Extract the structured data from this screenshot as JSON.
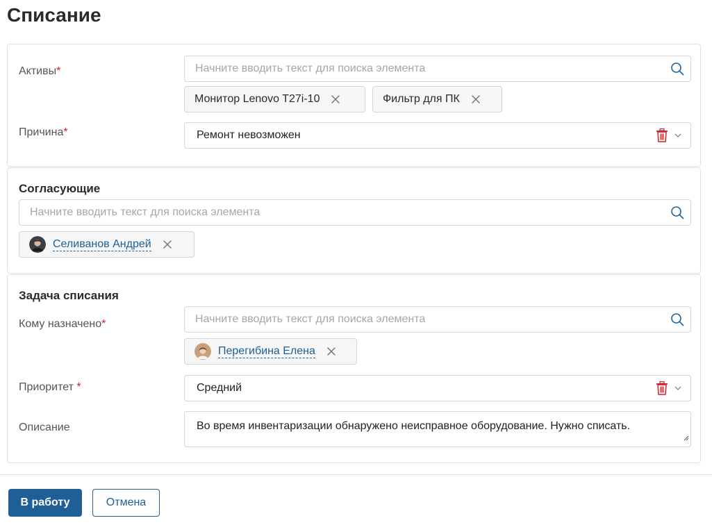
{
  "page": {
    "title": "Списание"
  },
  "assets": {
    "label": "Активы",
    "required_mark": "*",
    "search_placeholder": "Начните вводить текст для поиска элемента",
    "chips": [
      {
        "label": "Монитор Lenovo T27i-10"
      },
      {
        "label": "Фильтр для ПК"
      }
    ]
  },
  "reason": {
    "label": "Причина",
    "required_mark": "*",
    "value": "Ремонт невозможен"
  },
  "approvers": {
    "title": "Согласующие",
    "search_placeholder": "Начните вводить текст для поиска элемента",
    "chips": [
      {
        "label": "Селиванов Андрей"
      }
    ]
  },
  "task": {
    "title": "Задача списания",
    "assignee": {
      "label": "Кому назначено",
      "required_mark": "*",
      "search_placeholder": "Начните вводить текст для поиска элемента",
      "chips": [
        {
          "label": "Перегибина Елена"
        }
      ]
    },
    "priority": {
      "label": "Приоритет",
      "required_mark": " *",
      "value": "Средний"
    },
    "description": {
      "label": "Описание",
      "value": "Во время инвентаризации обнаружено неисправное оборудование. Нужно списать."
    }
  },
  "actions": {
    "submit_label": "В работу",
    "cancel_label": "Отмена"
  },
  "colors": {
    "accent": "#1f5f96",
    "link": "#1b5f94",
    "required": "#d0202a",
    "delete_icon": "#d0202a"
  }
}
